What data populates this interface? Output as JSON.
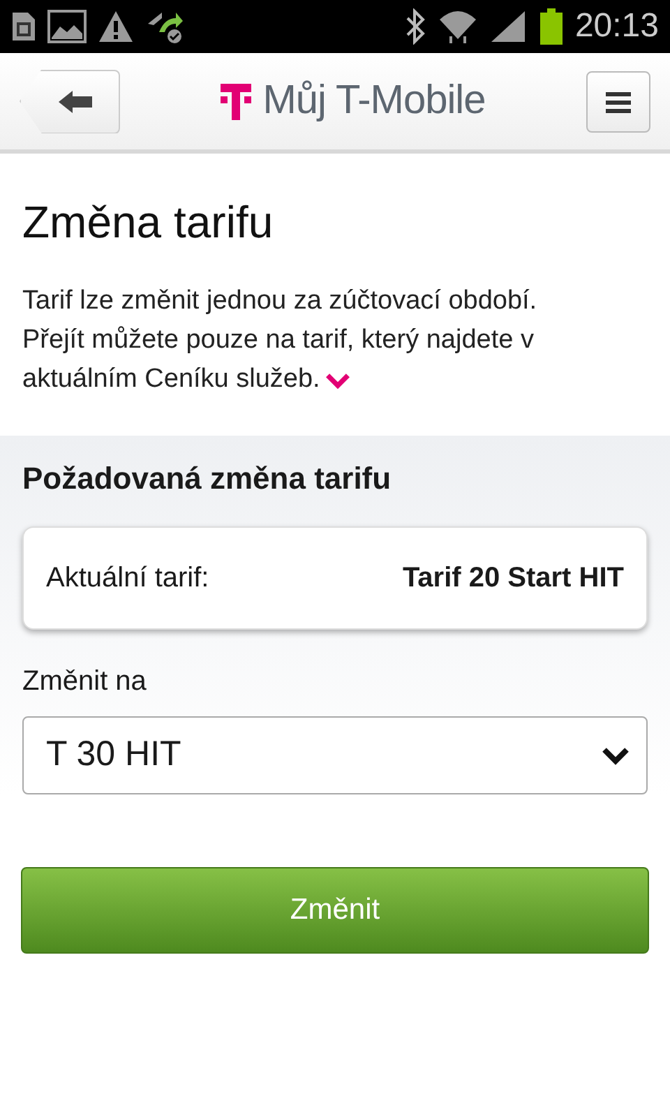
{
  "status_bar": {
    "time": "20:13"
  },
  "header": {
    "title": "Můj T-Mobile"
  },
  "page_title": "Změna tarifu",
  "intro_lines": [
    "Tarif lze změnit jednou za zúčtovací období.",
    "Přejít můžete pouze na tarif, který najdete v",
    "aktuálním Ceníku služeb."
  ],
  "form": {
    "heading": "Požadovaná změna tarifu",
    "current": {
      "label": "Aktuální tarif:",
      "value": "Tarif 20 Start HIT"
    },
    "change_label": "Změnit na",
    "select_value": "T 30 HIT",
    "submit": "Změnit"
  }
}
